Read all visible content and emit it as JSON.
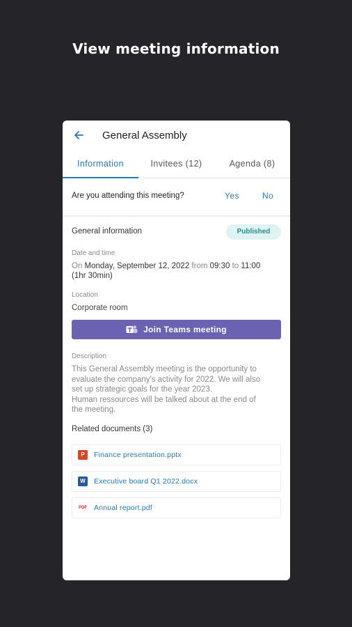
{
  "promo": {
    "title": "View meeting information"
  },
  "appbar": {
    "title": "General Assembly"
  },
  "tabs": [
    {
      "label": "Information",
      "active": true
    },
    {
      "label": "Invitees (12)",
      "active": false
    },
    {
      "label": "Agenda (8)",
      "active": false
    }
  ],
  "attendance": {
    "question": "Are you attending this meeting?",
    "yes": "Yes",
    "no": "No"
  },
  "general": {
    "heading": "General information",
    "status": "Published",
    "date_label": "Date and time",
    "date_on": "On",
    "date_value": "Monday, September 12, 2022",
    "date_from": "from",
    "start": "09:30",
    "date_to": "to",
    "end": "11:00",
    "duration": "(1hr 30min)",
    "location_label": "Location",
    "location_value": "Corporate room",
    "teams_button": "Join Teams meeting",
    "description_label": "Description",
    "description_lines": [
      "This General Assembly meeting is the opportunity to",
      "evaluate the company's activity for 2022. We will also",
      "set up strategic goals for the year 2023.",
      "Human ressources will be talked about at the end of",
      "the meeting."
    ]
  },
  "related": {
    "heading": "Related documents (3)",
    "documents": [
      {
        "name": "Finance presentation.pptx",
        "icon": "powerpoint-icon",
        "icon_text": "P",
        "color": "#d24726"
      },
      {
        "name": "Executive board Q1 2022.docx",
        "icon": "word-icon",
        "icon_text": "W",
        "color": "#2b579a"
      },
      {
        "name": "Annual report.pdf",
        "icon": "pdf-icon",
        "icon_text": "PDF",
        "color": "#e5252a"
      }
    ]
  },
  "colors": {
    "background": "#252428",
    "accent": "#2a78b5",
    "teams": "#6b62b2",
    "badge_bg": "#def3f2",
    "badge_text": "#2c8a8e"
  }
}
